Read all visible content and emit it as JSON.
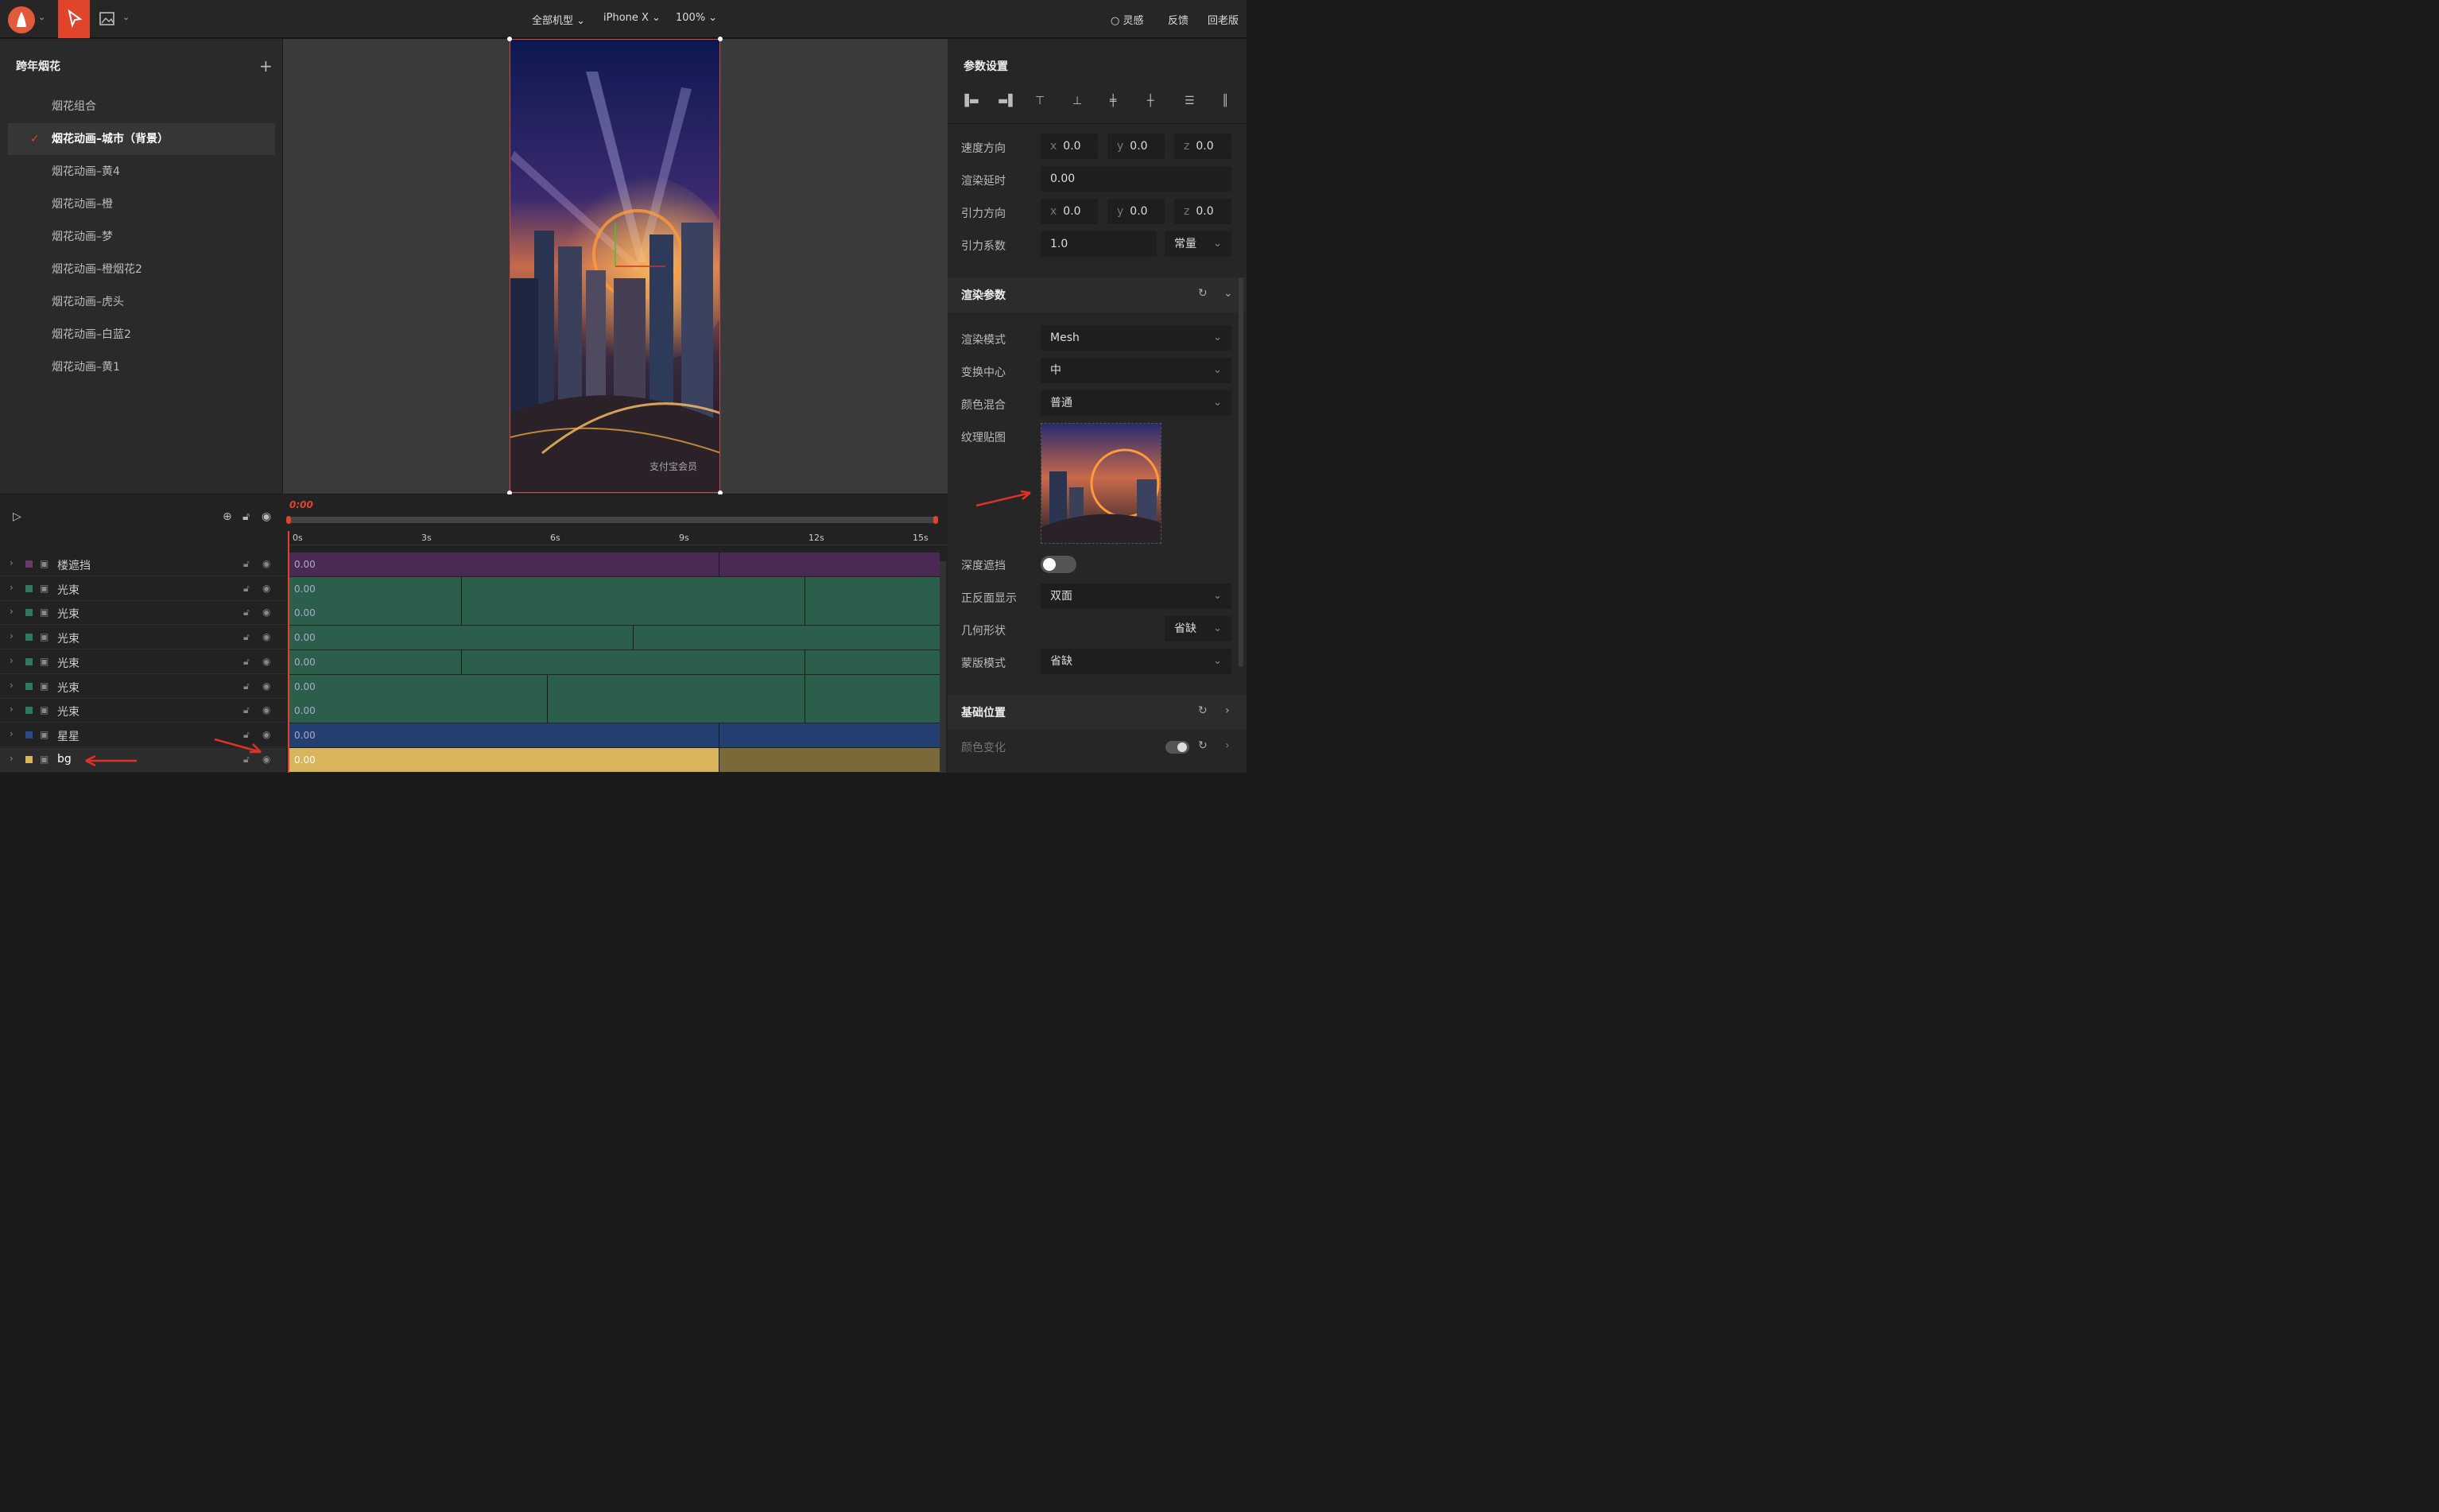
{
  "topbar": {
    "device": "全部机型",
    "model": "iPhone X",
    "zoom": "100%",
    "inspiration": "灵感",
    "feedback": "反馈",
    "old_version": "回老版"
  },
  "scene": {
    "title": "跨年烟花",
    "items": [
      {
        "label": "烟花组合",
        "selected": false
      },
      {
        "label": "烟花动画–城市（背景）",
        "selected": true
      },
      {
        "label": "烟花动画–黄4",
        "selected": false
      },
      {
        "label": "烟花动画–橙",
        "selected": false
      },
      {
        "label": "烟花动画–梦",
        "selected": false
      },
      {
        "label": "烟花动画–橙烟花2",
        "selected": false
      },
      {
        "label": "烟花动画–虎头",
        "selected": false
      },
      {
        "label": "烟花动画–白蓝2",
        "selected": false
      },
      {
        "label": "烟花动画–黄1",
        "selected": false
      }
    ]
  },
  "canvas": {
    "watermark": "支付宝会员"
  },
  "timeline": {
    "time": "0:00",
    "ticks": [
      "0s",
      "3s",
      "6s",
      "9s",
      "12s",
      "15s"
    ],
    "tracks": [
      {
        "name": "楼遮挡",
        "color": "#6a3a6a",
        "bar": "#4a2a52",
        "value": "0.00"
      },
      {
        "name": "光束",
        "color": "#2e7a5e",
        "bar": "#2c5e4c",
        "value": "0.00"
      },
      {
        "name": "光束",
        "color": "#2e7a5e",
        "bar": "#2c5e4c",
        "value": "0.00"
      },
      {
        "name": "光束",
        "color": "#2e7a5e",
        "bar": "#2c5e4c",
        "value": "0.00"
      },
      {
        "name": "光束",
        "color": "#2e7a5e",
        "bar": "#2c5e4c",
        "value": "0.00"
      },
      {
        "name": "光束",
        "color": "#2e7a5e",
        "bar": "#2c5e4c",
        "value": "0.00"
      },
      {
        "name": "光束",
        "color": "#2e7a5e",
        "bar": "#2c5e4c",
        "value": "0.00"
      },
      {
        "name": "星星",
        "color": "#2a4a8a",
        "bar": "#253f72",
        "value": "0.00"
      },
      {
        "name": "bg",
        "color": "#d8b45a",
        "bar": "#d8b45a",
        "value": "0.00"
      }
    ]
  },
  "params": {
    "title": "参数设置",
    "speed_dir": {
      "label": "速度方向",
      "x": "0.0",
      "y": "0.0",
      "z": "0.0"
    },
    "render_delay": {
      "label": "渲染延时",
      "value": "0.00"
    },
    "gravity_dir": {
      "label": "引力方向",
      "x": "0.0",
      "y": "0.0",
      "z": "0.0"
    },
    "gravity_coef": {
      "label": "引力系数",
      "value": "1.0",
      "mode": "常量"
    },
    "render_section": "渲染参数",
    "render_mode": {
      "label": "渲染模式",
      "value": "Mesh"
    },
    "transform_center": {
      "label": "变换中心",
      "value": "中"
    },
    "color_blend": {
      "label": "颜色混合",
      "value": "普通"
    },
    "texture": {
      "label": "纹理贴图"
    },
    "depth_occlusion": {
      "label": "深度遮挡"
    },
    "double_side": {
      "label": "正反面显示",
      "value": "双面"
    },
    "geometry": {
      "label": "几何形状",
      "value": "省缺"
    },
    "mask_mode": {
      "label": "蒙版模式",
      "value": "省缺"
    },
    "base_position": "基础位置",
    "color_change": "颜色变化"
  },
  "axis": {
    "x": "x",
    "y": "y",
    "z": "z"
  },
  "colors": {
    "accent": "#e0442a"
  }
}
